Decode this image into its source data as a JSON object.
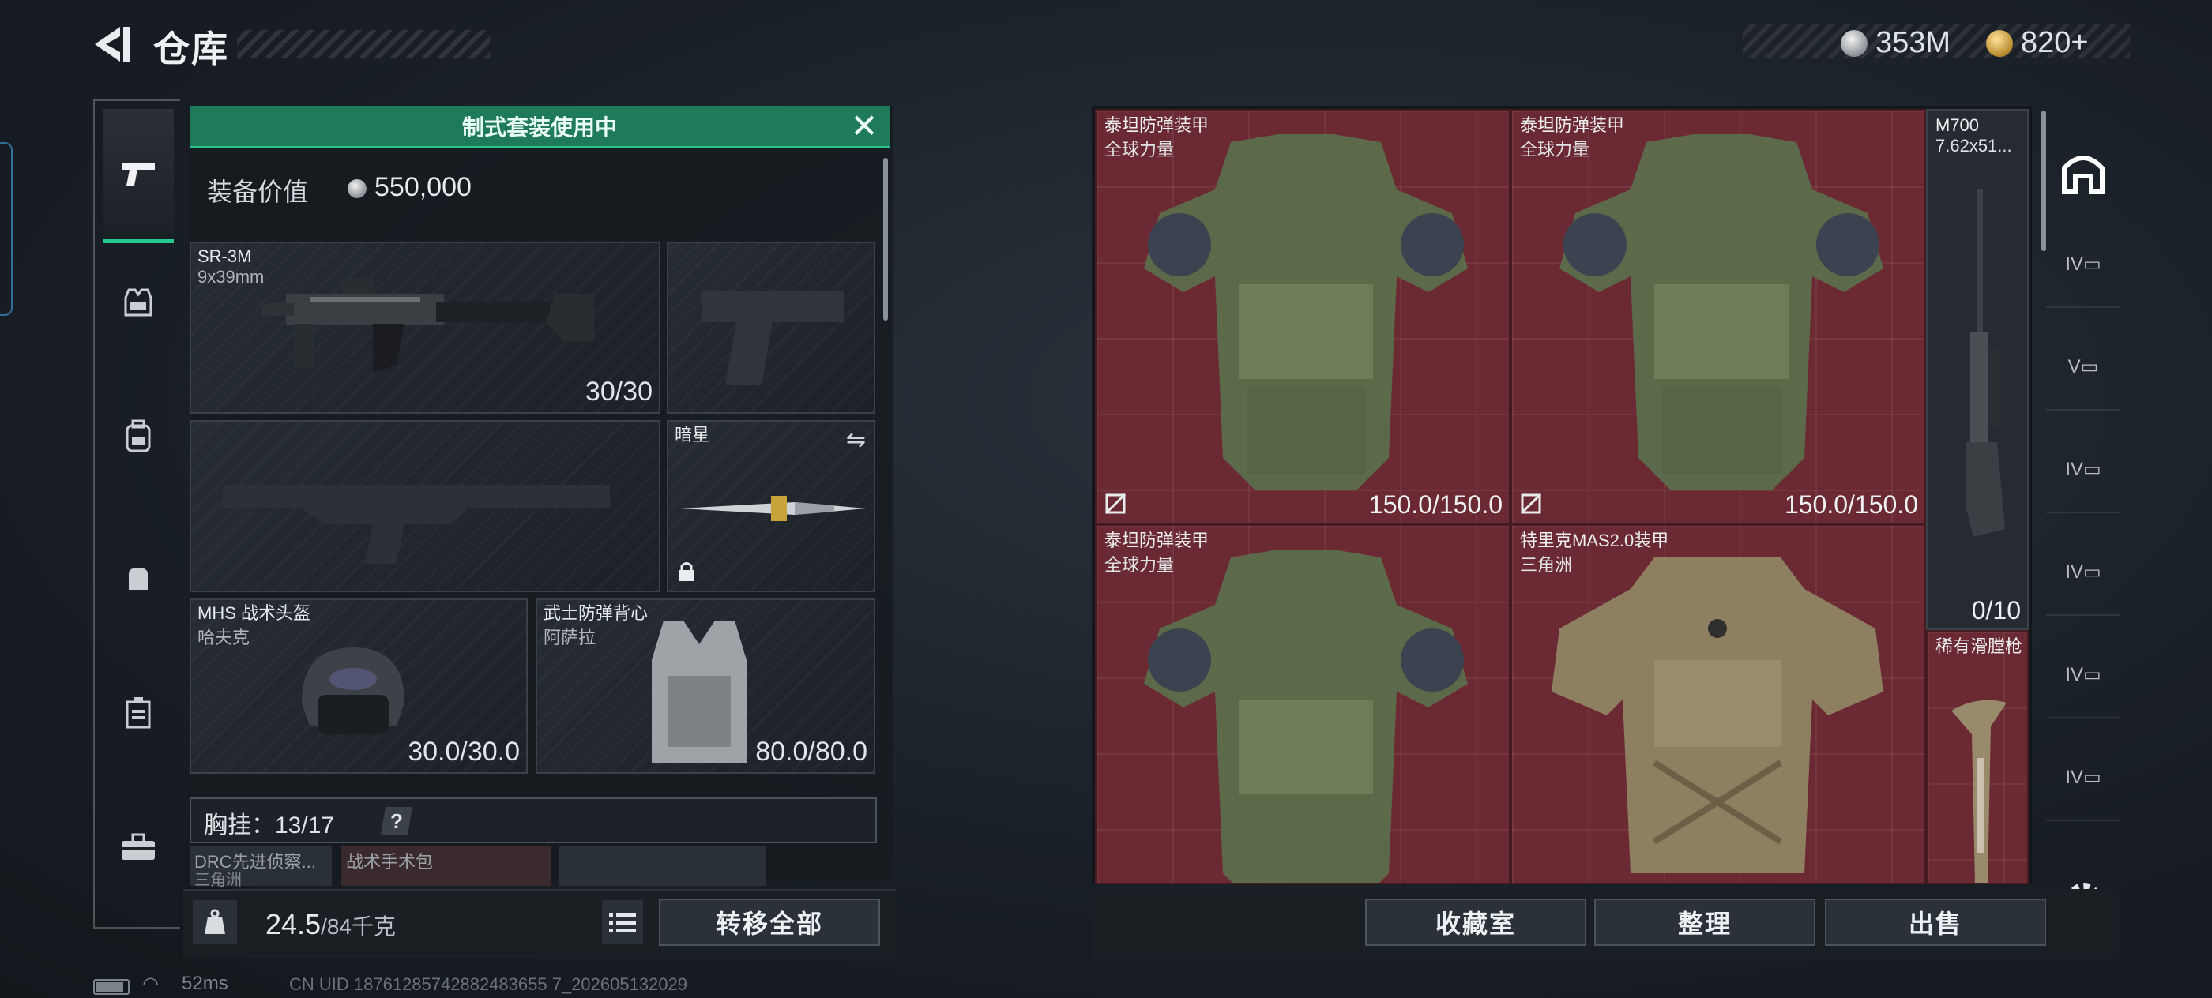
{
  "header": {
    "title": "仓库",
    "currency_silver": "353M",
    "currency_gold": "820+"
  },
  "loadout": {
    "banner": "制式套装使用中",
    "value_label": "装备价值",
    "value": "550,000",
    "primary": {
      "name": "SR-3M",
      "ammo": "9x39mm",
      "count": "30/30"
    },
    "melee": {
      "name": "暗星"
    },
    "helmet": {
      "name": "MHS 战术头盔",
      "map": "哈夫克",
      "durability": "30.0/30.0"
    },
    "armor": {
      "name": "武士防弹背心",
      "map": "阿萨拉",
      "durability": "80.0/80.0"
    },
    "chest_rig": {
      "label": "胸挂：",
      "count": "13/17",
      "help": "?"
    },
    "rig_slots": [
      {
        "name": "DRC先进侦察...",
        "map": "三角洲"
      },
      {
        "name": "战术手术包",
        "map": ""
      }
    ],
    "weight_value": "24.5",
    "weight_max": "/84千克",
    "transfer_label": "转移全部"
  },
  "stash": {
    "items": [
      {
        "name": "泰坦防弹装甲",
        "map": "全球力量",
        "durability": "150.0/150.0"
      },
      {
        "name": "泰坦防弹装甲",
        "map": "全球力量",
        "durability": "150.0/150.0"
      },
      {
        "name": "泰坦防弹装甲",
        "map": "全球力量"
      },
      {
        "name": "特里克MAS2.0装甲",
        "map": "三角洲"
      }
    ],
    "rifle": {
      "name": "M700",
      "ammo": "7.62x51...",
      "count": "0/10"
    },
    "musket": {
      "name": "稀有滑膛枪"
    },
    "buttons": {
      "collection": "收藏室",
      "sort": "整理",
      "sell": "出售"
    }
  },
  "status": {
    "ping": "52ms",
    "uid": "CN UID 18761285742882483655 7_202605132029"
  },
  "colors": {
    "accent_green": "#1f7a5a",
    "stash_red": "#6b2a33"
  }
}
